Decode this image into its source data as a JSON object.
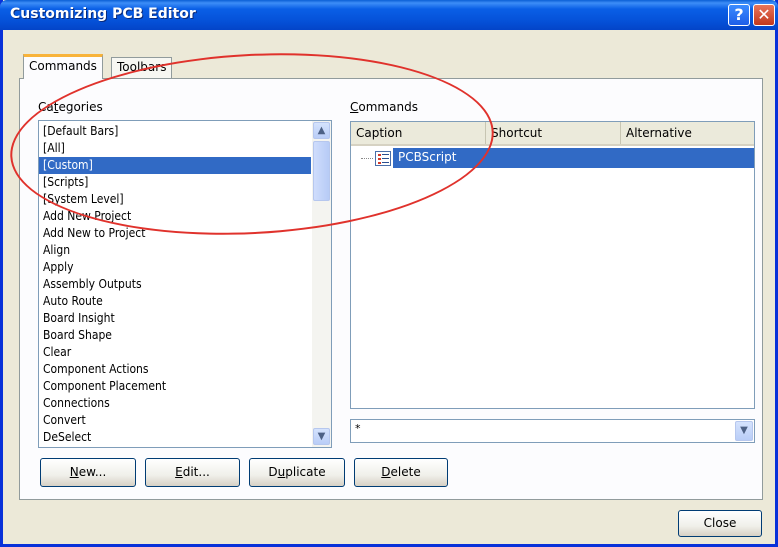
{
  "window": {
    "title": "Customizing PCB Editor",
    "help_glyph": "?",
    "close_glyph": "✕"
  },
  "tabs": [
    {
      "label": "Commands",
      "active": true
    },
    {
      "label": "Toolbars",
      "active": false
    }
  ],
  "categories": {
    "label_prefix": "Ca",
    "label_accel": "t",
    "label_suffix": "egories",
    "items": [
      "[Default Bars]",
      "[All]",
      "[Custom]",
      "[Scripts]",
      "[System Level]",
      "Add New Project",
      "Add New to Project",
      "Align",
      "Apply",
      "Assembly Outputs",
      "Auto Route",
      "Board Insight",
      "Board Shape",
      "Clear",
      "Component Actions",
      "Component Placement",
      "Connections",
      "Convert",
      "DeSelect"
    ],
    "selected_index": 2,
    "scroll_up": "▲",
    "scroll_down": "▼"
  },
  "commands": {
    "label_accel": "C",
    "label_suffix": "ommands",
    "columns": [
      "Caption",
      "Shortcut",
      "Alternative"
    ],
    "rows": [
      {
        "caption": "PCBScript",
        "shortcut": "",
        "alternative": ""
      }
    ]
  },
  "filter": {
    "value": "*",
    "drop": "▼"
  },
  "buttons": {
    "new": {
      "accel": "N",
      "rest": "ew..."
    },
    "edit": {
      "accel": "E",
      "rest": "dit..."
    },
    "duplicate": {
      "pre": "D",
      "accel": "u",
      "rest": "plicate"
    },
    "delete": {
      "accel": "D",
      "rest": "elete"
    },
    "close": "Close"
  },
  "colors": {
    "selection": "#316ac5",
    "annotation": "#e0322c",
    "titlebar": "#0a5fe6"
  }
}
